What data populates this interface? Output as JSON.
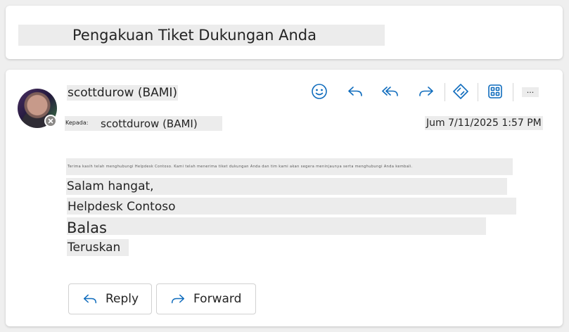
{
  "subject": "Pengakuan Tiket Dukungan Anda",
  "sender": {
    "name": "scottdurow (BAMI)",
    "presence": "blocked-icon"
  },
  "recipient": {
    "label": "Kepada:",
    "value": "scottdurow (BAMI)"
  },
  "date": "Jum 7/11/2025 1:57 PM",
  "toolbar": {
    "icons": [
      "emoji-icon",
      "reply-icon",
      "reply-all-icon",
      "forward-icon",
      "copilot-icon",
      "apps-icon"
    ],
    "more_label": "..."
  },
  "body": {
    "garbled_line": "Terima kasih telah menghubungi Helpdesk Contoso. Kami telah menerima tiket dukungan Anda dan tim kami akan segera meninjaunya serta menghubungi Anda kembali.",
    "greeting": "Salam hangat,",
    "signature": "Helpdesk Contoso",
    "balas": "Balas",
    "teruskan": "Teruskan"
  },
  "actions": {
    "reply_label": "Reply",
    "forward_label": "Forward"
  },
  "colors": {
    "accent": "#0f6cbd",
    "highlight": "#ececec",
    "background": "#efefef"
  }
}
